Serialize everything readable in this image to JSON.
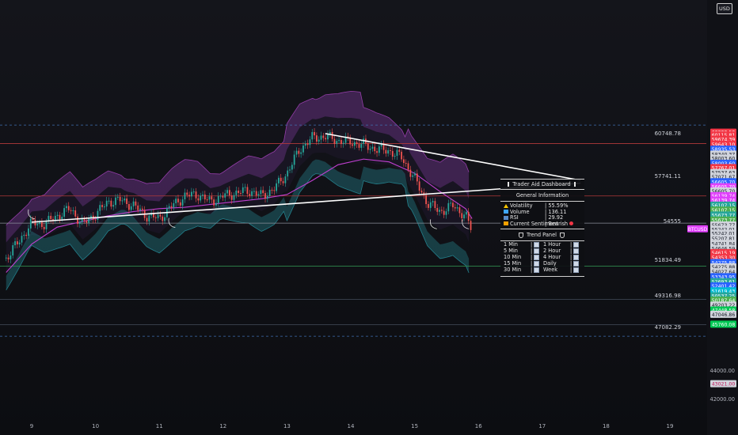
{
  "chart_data": {
    "type": "line",
    "symbol": "BTCUSD",
    "currency": "USD",
    "x_ticks": [
      "9",
      "10",
      "11",
      "12",
      "13",
      "14",
      "15",
      "16",
      "17",
      "18",
      "19"
    ],
    "y_ticks": [
      "44000.00",
      "42000.00"
    ],
    "level_labels": [
      {
        "value": 60748.78,
        "text": "60748.78"
      },
      {
        "value": 57741.11,
        "text": "57741.11"
      },
      {
        "value": 54555,
        "text": "54555"
      },
      {
        "value": 51834.49,
        "text": "51834.49"
      },
      {
        "value": 49316.98,
        "text": "49316.98"
      },
      {
        "value": 47082.29,
        "text": "47082.29"
      }
    ],
    "level_lines": [
      {
        "value": 61300,
        "color": "#3f6fb0",
        "style": "dashed"
      },
      {
        "value": 60000,
        "color": "#b23a3a",
        "style": "solid"
      },
      {
        "value": 56300,
        "color": "#b23a3a",
        "style": "solid"
      },
      {
        "value": 54380,
        "color": "#8a8f99",
        "style": "solid"
      },
      {
        "value": 51350,
        "color": "#2f8a4c",
        "style": "solid"
      },
      {
        "value": 49000,
        "color": "#3d4450",
        "style": "solid"
      },
      {
        "value": 47220,
        "color": "#3d4450",
        "style": "solid"
      },
      {
        "value": 46400,
        "color": "#3f6fb0",
        "style": "dashed"
      }
    ],
    "price_badges": [
      {
        "value": 60800,
        "text": "60200.50",
        "bg": "#f23645",
        "fg": "#ffffff"
      },
      {
        "value": 60600,
        "text": "60115.81",
        "bg": "#f23645",
        "fg": "#ffffff"
      },
      {
        "value": 60300,
        "text": "59674.39",
        "bg": "#f23645",
        "fg": "#ffffff"
      },
      {
        "value": 59950,
        "text": "59643.10",
        "bg": "#f23645",
        "fg": "#ffffff"
      },
      {
        "value": 59600,
        "text": "58935.53",
        "bg": "#2962ff",
        "fg": "#ffffff"
      },
      {
        "value": 59250,
        "text": "58340.37",
        "bg": "#d1d4dc",
        "fg": "#131722"
      },
      {
        "value": 58950,
        "text": "58003.60",
        "bg": "#d1d4dc",
        "fg": "#131722"
      },
      {
        "value": 58600,
        "text": "58003.60",
        "bg": "#2962ff",
        "fg": "#ffffff"
      },
      {
        "value": 58300,
        "text": "57767.01",
        "bg": "#f23645",
        "fg": "#ffffff"
      },
      {
        "value": 57950,
        "text": "57537.63",
        "bg": "#d1d4dc",
        "fg": "#131722"
      },
      {
        "value": 57650,
        "text": "57071.67",
        "bg": "#d1d4dc",
        "fg": "#131722"
      },
      {
        "value": 57300,
        "text": "56605.70",
        "bg": "#2962ff",
        "fg": "#ffffff"
      },
      {
        "value": 56950,
        "text": "56605.70",
        "bg": "#e040fb",
        "fg": "#ffffff"
      },
      {
        "value": 56650,
        "text": "56605.70",
        "bg": "#d1d4dc",
        "fg": "#131722"
      },
      {
        "value": 56320,
        "text": "56139.74",
        "bg": "#e040fb",
        "fg": "#ffffff"
      },
      {
        "value": 56000,
        "text": "56139.74",
        "bg": "#e040fb",
        "fg": "#ffffff"
      },
      {
        "value": 55650,
        "text": "56107.15",
        "bg": "#26a69a",
        "fg": "#ffffff"
      },
      {
        "value": 55300,
        "text": "56107.15",
        "bg": "#4caf50",
        "fg": "#ffffff"
      },
      {
        "value": 54950,
        "text": "55673.77",
        "bg": "#26a69a",
        "fg": "#ffffff"
      },
      {
        "value": 54600,
        "text": "55673.77",
        "bg": "#4caf50",
        "fg": "#ffffff"
      },
      {
        "value": 54250,
        "text": "55673.77",
        "bg": "#d1d4dc",
        "fg": "#131722"
      },
      {
        "value": 53950,
        "text": "55242.01",
        "bg": "#d1d4dc",
        "fg": "#131722"
      },
      {
        "value": 53650,
        "text": "55242.01",
        "bg": "#d1d4dc",
        "fg": "#131722"
      },
      {
        "value": 53300,
        "text": "55207.81",
        "bg": "#d1d4dc",
        "fg": "#131722"
      },
      {
        "value": 52950,
        "text": "54741.84",
        "bg": "#d1d4dc",
        "fg": "#131722"
      },
      {
        "value": 52600,
        "text": "54646.59",
        "bg": "#d1d4dc",
        "fg": "#131722"
      },
      {
        "value": 52300,
        "text": "54615.19",
        "bg": "#f23645",
        "fg": "#ffffff"
      },
      {
        "value": 51950,
        "text": "54353.30",
        "bg": "#f23645",
        "fg": "#ffffff"
      },
      {
        "value": 51600,
        "text": "54275.88",
        "bg": "#2962ff",
        "fg": "#ffffff"
      },
      {
        "value": 51300,
        "text": "54275.88",
        "bg": "#d1d4dc",
        "fg": "#131722"
      },
      {
        "value": 50950,
        "text": "54027.64",
        "bg": "#d1d4dc",
        "fg": "#131722"
      },
      {
        "value": 50600,
        "text": "53343.95",
        "bg": "#2962ff",
        "fg": "#ffffff"
      },
      {
        "value": 50250,
        "text": "52693.61",
        "bg": "#26a69a",
        "fg": "#ffffff"
      },
      {
        "value": 49950,
        "text": "52401.42",
        "bg": "#2962ff",
        "fg": "#ffffff"
      },
      {
        "value": 49600,
        "text": "51619.43",
        "bg": "#00bcd4",
        "fg": "#ffffff"
      },
      {
        "value": 49250,
        "text": "50537.25",
        "bg": "#26a69a",
        "fg": "#ffffff"
      },
      {
        "value": 48950,
        "text": "50187.64",
        "bg": "#4caf50",
        "fg": "#ffffff"
      },
      {
        "value": 48600,
        "text": "49203.22",
        "bg": "#d1d4dc",
        "fg": "#131722"
      },
      {
        "value": 48250,
        "text": "47448.58",
        "bg": "#00c853",
        "fg": "#ffffff"
      },
      {
        "value": 47950,
        "text": "47046.86",
        "bg": "#d1d4dc",
        "fg": "#131722"
      },
      {
        "value": 47250,
        "text": "45760.08",
        "bg": "#00c853",
        "fg": "#ffffff"
      },
      {
        "value": 43050,
        "text": "43021.00",
        "bg": "#d1d4dc",
        "fg": "#c2185b"
      }
    ],
    "symbol_badge": {
      "value": 53980,
      "text": "BTCUSD",
      "bg": "#e040fb",
      "fg": "#ffffff"
    },
    "price_series": {
      "x": [
        8.6,
        8.8,
        9.0,
        9.2,
        9.4,
        9.6,
        9.8,
        10.0,
        10.2,
        10.4,
        10.6,
        10.8,
        11.0,
        11.2,
        11.4,
        11.6,
        11.8,
        12.0,
        12.2,
        12.4,
        12.6,
        12.8,
        13.0,
        13.2,
        13.4,
        13.6,
        13.8,
        14.0,
        14.2,
        14.4,
        14.6,
        14.8,
        15.0,
        15.2,
        15.4,
        15.6,
        15.8,
        15.9
      ],
      "close": [
        51900,
        53100,
        54400,
        54300,
        54900,
        55400,
        54300,
        55000,
        55900,
        56000,
        55600,
        54900,
        54700,
        55600,
        56300,
        56400,
        55900,
        56300,
        56500,
        56700,
        56300,
        56800,
        57900,
        59600,
        60400,
        60500,
        60200,
        60100,
        59900,
        59600,
        59500,
        59000,
        57500,
        55800,
        55200,
        55600,
        54900,
        53800
      ]
    },
    "ma_line": {
      "x": [
        8.6,
        9.0,
        9.4,
        9.8,
        10.2,
        10.6,
        11.0,
        11.4,
        11.8,
        12.2,
        12.6,
        13.0,
        13.4,
        13.8,
        14.2,
        14.6,
        15.0,
        15.4,
        15.8,
        15.9
      ],
      "y": [
        50900,
        52900,
        54100,
        54500,
        54900,
        55200,
        55400,
        55500,
        55700,
        55900,
        56100,
        56400,
        57400,
        58500,
        58900,
        58700,
        57900,
        56600,
        55400,
        54700
      ]
    },
    "trendlines": [
      {
        "x": [
          13.6,
          17.6
        ],
        "y": [
          60700,
          57400
        ]
      },
      {
        "x": [
          9.0,
          17.6
        ],
        "y": [
          54450,
          57200
        ]
      }
    ],
    "dashboard": {
      "title": "Trader Aid Dashboard",
      "section1": "General Information",
      "rows": [
        {
          "label": "Volatility",
          "value": "| 55.59%"
        },
        {
          "label": "Volume",
          "value": "| 136.11"
        },
        {
          "label": "RSI",
          "value": "| 29.92"
        },
        {
          "label": "Current Sentiment",
          "value": "| Bearish"
        }
      ],
      "section2": "Trend Panel",
      "trend_left": [
        "1 Min",
        "5 Min",
        "10 Min",
        "15 Min",
        "30 Min"
      ],
      "trend_right": [
        "1 Hour",
        "2 Hour",
        "4 Hour",
        "Daily",
        "Week"
      ]
    }
  }
}
